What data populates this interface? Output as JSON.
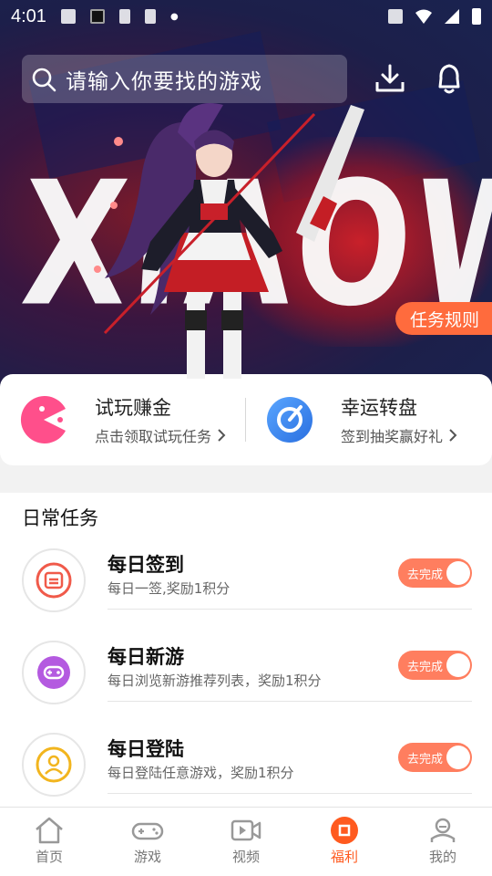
{
  "status_bar": {
    "time": "4:01"
  },
  "search": {
    "placeholder": "请输入你要找的游戏"
  },
  "banner": {
    "title_art": "XIAOWAN",
    "rules_button": "任务规则"
  },
  "quick_cards": [
    {
      "title": "试玩赚金",
      "subtitle": "点击领取试玩任务",
      "icon": "pacman-icon",
      "color": "#ff4f8b"
    },
    {
      "title": "幸运转盘",
      "subtitle": "签到抽奖赢好礼",
      "icon": "wheel-icon",
      "color": "#3d8cf5"
    }
  ],
  "daily": {
    "title": "日常任务",
    "tasks": [
      {
        "name": "每日签到",
        "desc": "每日一签,奖励1积分",
        "button": "去完成",
        "icon": "calendar-icon",
        "color": "#f05a4a"
      },
      {
        "name": "每日新游",
        "desc": "每日浏览新游推荐列表，奖励1积分",
        "button": "去完成",
        "icon": "gamepad-icon",
        "color": "#b45ae0"
      },
      {
        "name": "每日登陆",
        "desc": "每日登陆任意游戏，奖励1积分",
        "button": "去完成",
        "icon": "user-icon",
        "color": "#f2b51e"
      }
    ]
  },
  "nav": {
    "tabs": [
      {
        "label": "首页",
        "icon": "home-icon",
        "active": false
      },
      {
        "label": "游戏",
        "icon": "gamepad-icon",
        "active": false
      },
      {
        "label": "视频",
        "icon": "video-icon",
        "active": false
      },
      {
        "label": "福利",
        "icon": "gift-icon",
        "active": true
      },
      {
        "label": "我的",
        "icon": "profile-icon",
        "active": false
      }
    ],
    "active_color": "#ff5a1f"
  }
}
